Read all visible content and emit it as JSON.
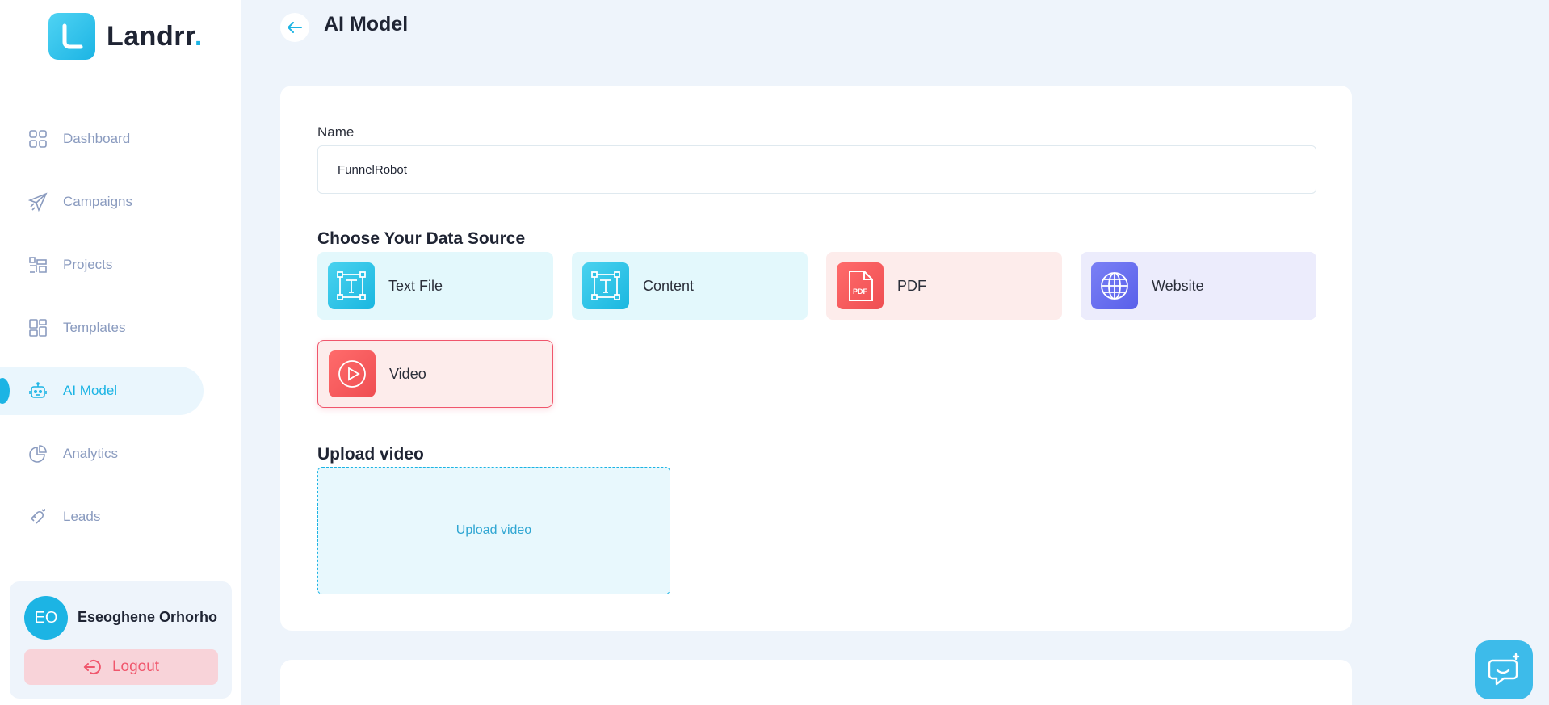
{
  "app": {
    "brand": "Landrr",
    "brand_dot": ".",
    "accent": "#1cb4e4"
  },
  "sidebar": {
    "items": [
      {
        "label": "Dashboard",
        "icon": "grid-icon"
      },
      {
        "label": "Campaigns",
        "icon": "paper-plane-icon"
      },
      {
        "label": "Projects",
        "icon": "projects-icon"
      },
      {
        "label": "Templates",
        "icon": "layout-icon"
      },
      {
        "label": "AI Model",
        "icon": "robot-icon",
        "active": true
      },
      {
        "label": "Analytics",
        "icon": "pie-chart-icon"
      },
      {
        "label": "Leads",
        "icon": "magnet-icon"
      }
    ],
    "user": {
      "initials": "EO",
      "name": "Eseoghene Orhorho",
      "logout_label": "Logout"
    }
  },
  "header": {
    "title": "AI Model"
  },
  "form": {
    "name_label": "Name",
    "name_value": "FunnelRobot",
    "data_source_title": "Choose Your Data Source",
    "sources": [
      {
        "label": "Text File",
        "icon": "text-file-icon"
      },
      {
        "label": "Content",
        "icon": "content-icon"
      },
      {
        "label": "PDF",
        "icon": "pdf-icon"
      },
      {
        "label": "Website",
        "icon": "globe-icon"
      },
      {
        "label": "Video",
        "icon": "play-icon",
        "selected": true
      }
    ],
    "upload_title": "Upload video",
    "upload_button": "Upload video"
  },
  "support": {
    "icon": "chat-icon"
  }
}
